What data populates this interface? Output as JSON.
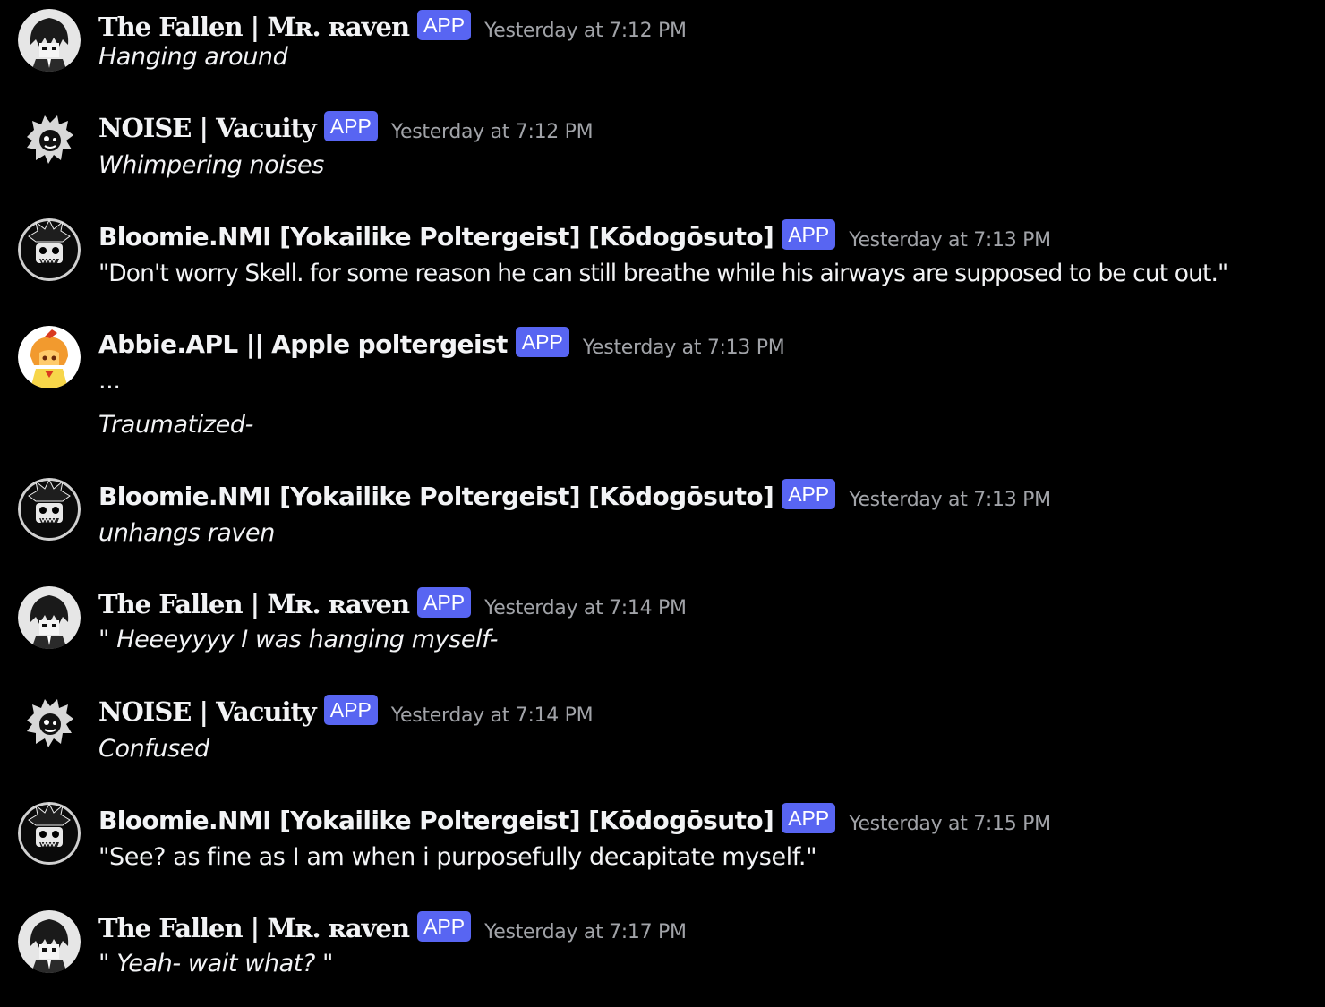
{
  "badge_label": "APP",
  "colors": {
    "background": "#000000",
    "badge": "#5865f2",
    "timestamp": "#a1a3a8",
    "text": "#f2f3f5"
  },
  "messages": [
    {
      "author": "The Fallen | Mʀ. ʀaven",
      "timestamp": "Yesterday at 7:12 PM",
      "lines": [
        "Hanging around"
      ]
    },
    {
      "author": "NOISE | Vacuity",
      "timestamp": "Yesterday at 7:12 PM",
      "lines": [
        "Whimpering noises"
      ]
    },
    {
      "author": "Bloomie.NMI [Yokailike Poltergeist] [Kōdogōsuto]",
      "timestamp": "Yesterday at 7:13 PM",
      "lines": [
        "\"Don't worry Skell. for some reason he can still breathe while his airways are supposed to be cut out.\""
      ]
    },
    {
      "author": "Abbie.APL || Apple poltergeist",
      "timestamp": "Yesterday at 7:13 PM",
      "lines": [
        "...",
        "Traumatized-"
      ]
    },
    {
      "author": "Bloomie.NMI [Yokailike Poltergeist] [Kōdogōsuto]",
      "timestamp": "Yesterday at 7:13 PM",
      "lines": [
        "unhangs raven"
      ]
    },
    {
      "author": "The Fallen | Mʀ. ʀaven",
      "timestamp": "Yesterday at 7:14 PM",
      "lines": [
        "\" Heeeyyyy I was hanging myself-"
      ]
    },
    {
      "author": "NOISE | Vacuity",
      "timestamp": "Yesterday at 7:14 PM",
      "lines": [
        "Confused"
      ]
    },
    {
      "author": "Bloomie.NMI [Yokailike Poltergeist] [Kōdogōsuto]",
      "timestamp": "Yesterday at 7:15 PM",
      "lines": [
        "\"See? as fine as I am when i purposefully decapitate myself.\""
      ]
    },
    {
      "author": "The Fallen | Mʀ. ʀaven",
      "timestamp": "Yesterday at 7:17 PM",
      "lines": [
        "\" Yeah- wait what? \""
      ]
    }
  ]
}
